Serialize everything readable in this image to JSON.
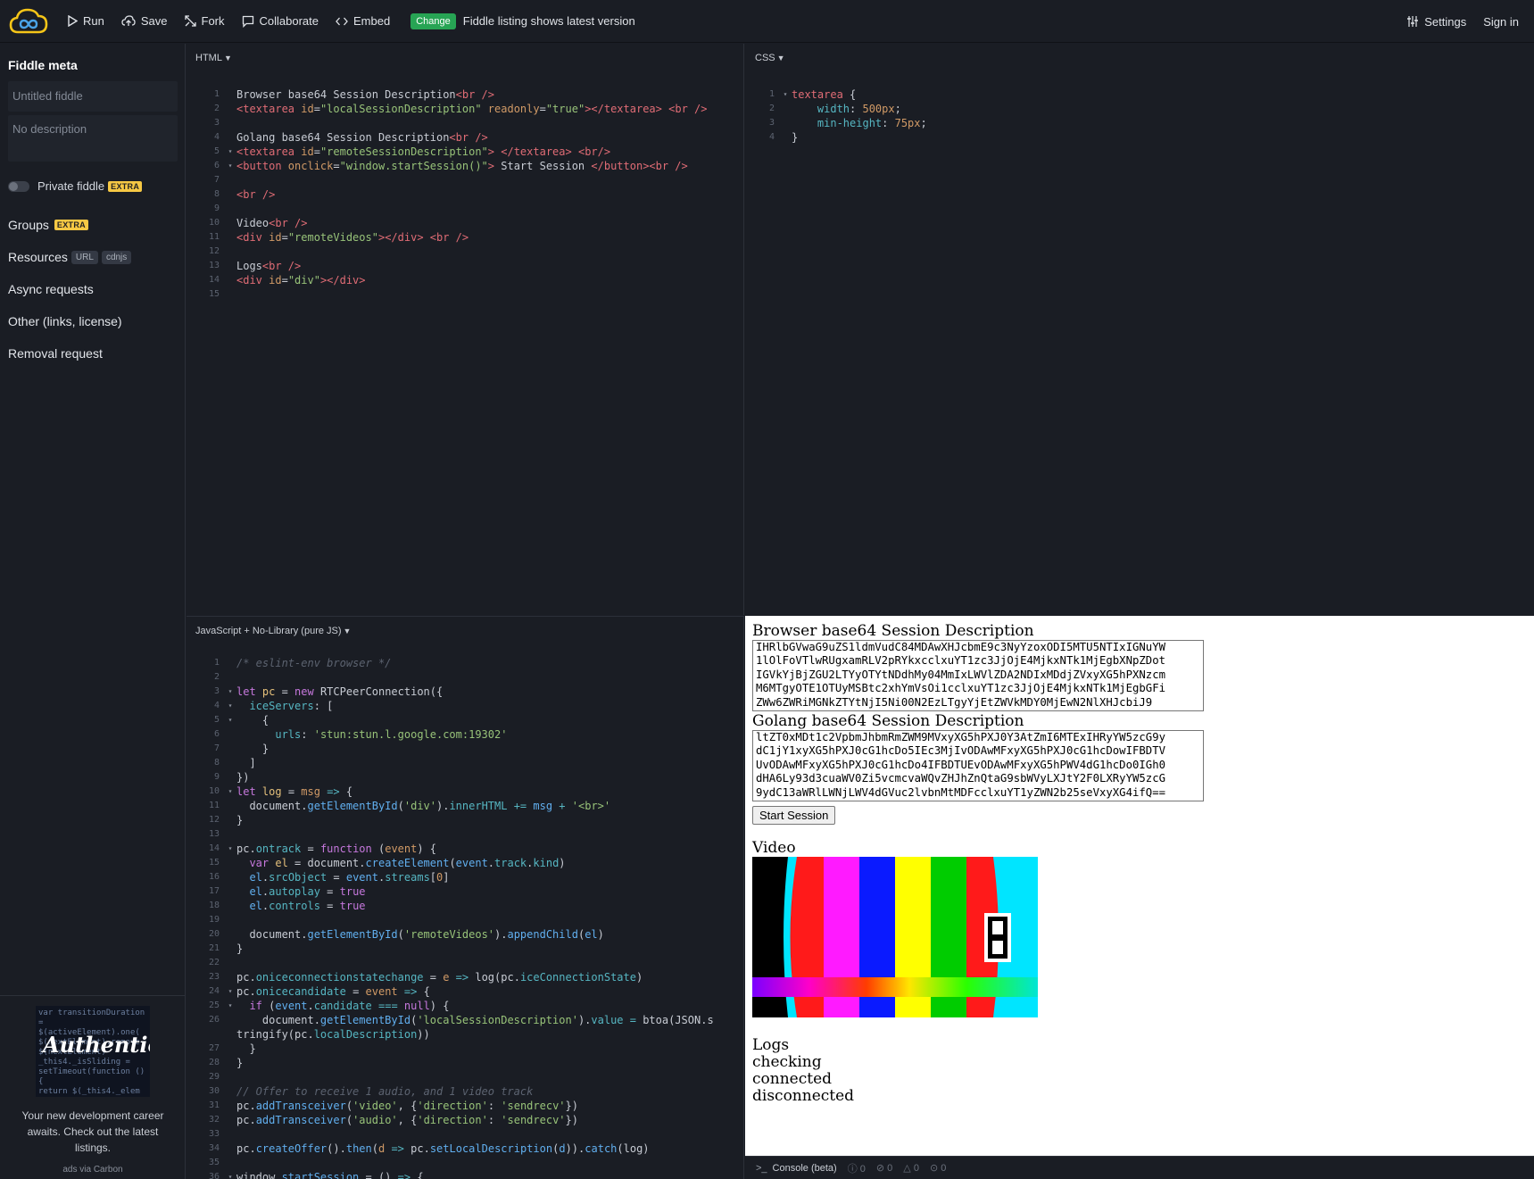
{
  "topbar": {
    "run": "Run",
    "save": "Save",
    "fork": "Fork",
    "collaborate": "Collaborate",
    "embed": "Embed",
    "change_badge": "Change",
    "notice": "Fiddle listing shows latest version",
    "settings": "Settings",
    "sign_in": "Sign in"
  },
  "sidebar": {
    "title": "Fiddle meta",
    "title_placeholder": "Untitled fiddle",
    "description_placeholder": "No description",
    "private_label": "Private fiddle",
    "extra_badge": "EXTRA",
    "groups": "Groups",
    "resources": "Resources",
    "resources_url": "URL",
    "resources_cdnjs": "cdnjs",
    "async": "Async requests",
    "other": "Other (links, license)",
    "removal": "Removal request"
  },
  "ad": {
    "word": "Authentic",
    "text": "Your new development career awaits. Check out the latest listings.",
    "via": "ads via Carbon"
  },
  "panels": {
    "html": "HTML",
    "css": "CSS",
    "js": "JavaScript + No-Library (pure JS)"
  },
  "result": {
    "browser_label": "Browser base64 Session Description",
    "browser_value": "IHRlbGVwaG9uZS1ldmVudC84MDAwXHJcbmE9c3NyYzoxODI5MTU5NTIxIGNuYW\n1lOlFoVTlwRUgxamRLV2pRYkxcclxuYT1zc3JjOjE4MjkxNTk1MjEgbXNpZDot\nIGVkYjBjZGU2LTYyOTYtNDdhMy04MmIxLWVlZDA2NDIxMDdjZVxyXG5hPXNzcm\nM6MTgyOTE1OTUyMSBtc2xhYmVsOi1cclxuYT1zc3JjOjE4MjkxNTk1MjEgbGFi\nZWw6ZWRiMGNkZTYtNjI5Ni00N2EzLTgyYjEtZWVkMDY0MjEwN2NlXHJcbiJ9",
    "golang_label": "Golang base64 Session Description",
    "golang_value": "ltZT0xMDt1c2VpbmJhbmRmZWM9MVxyXG5hPXJ0Y3AtZmI6MTExIHRyYW5zcG9y\ndC1jY1xyXG5hPXJ0cG1hcDo5IEc3MjIvODAwMFxyXG5hPXJ0cG1hcDowIFBDTV\nUvODAwMFxyXG5hPXJ0cG1hcDo4IFBDTUEvODAwMFxyXG5hPWV4dG1hcDo0IGh0\ndHA6Ly93d3cuaWV0Zi5vcmcvaWQvZHJhZnQtaG9sbWVyLXJtY2F0LXRyYW5zcG\n9ydC13aWRlLWNjLWV4dGVuc2lvbnMtMDFcclxuYT1yZWN2b25seVxyXG4ifQ==",
    "start_button": "Start Session",
    "video_label": "Video",
    "logs_label": "Logs",
    "logs": [
      "checking",
      "connected",
      "disconnected"
    ]
  },
  "console": {
    "label": "Console (beta)",
    "counts": [
      "0",
      "0",
      "0",
      "0"
    ]
  },
  "html_code": [
    [
      [
        "tx",
        "Browser base64 Session Description"
      ],
      [
        "tag",
        "<br />"
      ]
    ],
    [
      [
        "tag",
        "<textarea "
      ],
      [
        "attr",
        "id"
      ],
      [
        "tx",
        "="
      ],
      [
        "str",
        "\"localSessionDescription\""
      ],
      [
        "tx",
        " "
      ],
      [
        "attr",
        "readonly"
      ],
      [
        "tx",
        "="
      ],
      [
        "str",
        "\"true\""
      ],
      [
        "tag",
        "></textarea>"
      ],
      [
        "tx",
        " "
      ],
      [
        "tag",
        "<br />"
      ]
    ],
    [],
    [
      [
        "tx",
        "Golang base64 Session Description"
      ],
      [
        "tag",
        "<br />"
      ]
    ],
    [
      [
        "tag",
        "<textarea "
      ],
      [
        "attr",
        "id"
      ],
      [
        "tx",
        "="
      ],
      [
        "str",
        "\"remoteSessionDescription\""
      ],
      [
        "tag",
        ">"
      ],
      [
        "tx",
        " "
      ],
      [
        "tag",
        "</textarea>"
      ],
      [
        "tx",
        " "
      ],
      [
        "tag",
        "<br/>"
      ]
    ],
    [
      [
        "tag",
        "<button "
      ],
      [
        "attr",
        "onclick"
      ],
      [
        "tx",
        "="
      ],
      [
        "str",
        "\"window.startSession()\""
      ],
      [
        "tag",
        ">"
      ],
      [
        "tx",
        " Start Session "
      ],
      [
        "tag",
        "</button><br />"
      ]
    ],
    [],
    [
      [
        "tag",
        "<br />"
      ]
    ],
    [],
    [
      [
        "tx",
        "Video"
      ],
      [
        "tag",
        "<br />"
      ]
    ],
    [
      [
        "tag",
        "<div "
      ],
      [
        "attr",
        "id"
      ],
      [
        "tx",
        "="
      ],
      [
        "str",
        "\"remoteVideos\""
      ],
      [
        "tag",
        "></div>"
      ],
      [
        "tx",
        " "
      ],
      [
        "tag",
        "<br />"
      ]
    ],
    [],
    [
      [
        "tx",
        "Logs"
      ],
      [
        "tag",
        "<br />"
      ]
    ],
    [
      [
        "tag",
        "<div "
      ],
      [
        "attr",
        "id"
      ],
      [
        "tx",
        "="
      ],
      [
        "str",
        "\"div\""
      ],
      [
        "tag",
        "></div>"
      ]
    ],
    []
  ],
  "html_folds": [
    0,
    0,
    0,
    0,
    1,
    1,
    0,
    0,
    0,
    0,
    0,
    0,
    0,
    0,
    0
  ],
  "css_code": [
    [
      [
        "tag",
        "textarea"
      ],
      [
        "tx",
        " {"
      ]
    ],
    [
      [
        "tx",
        "    "
      ],
      [
        "prop",
        "width"
      ],
      [
        "tx",
        ": "
      ],
      [
        "num",
        "500px"
      ],
      [
        "tx",
        ";"
      ]
    ],
    [
      [
        "tx",
        "    "
      ],
      [
        "prop",
        "min-height"
      ],
      [
        "tx",
        ": "
      ],
      [
        "num",
        "75px"
      ],
      [
        "tx",
        ";"
      ]
    ],
    [
      [
        "tx",
        "}"
      ]
    ]
  ],
  "css_folds": [
    1,
    0,
    0,
    0
  ],
  "js_code": [
    [
      [
        "cmt",
        "/* eslint-env browser */"
      ]
    ],
    [],
    [
      [
        "kw",
        "let "
      ],
      [
        "vn",
        "pc"
      ],
      [
        "tx",
        " = "
      ],
      [
        "kw",
        "new "
      ],
      [
        "tx",
        "RTCPeerConnection({"
      ]
    ],
    [
      [
        "tx",
        "  "
      ],
      [
        "prop",
        "iceServers"
      ],
      [
        "tx",
        ": ["
      ]
    ],
    [
      [
        "tx",
        "    {"
      ]
    ],
    [
      [
        "tx",
        "      "
      ],
      [
        "prop",
        "urls"
      ],
      [
        "tx",
        ": "
      ],
      [
        "str",
        "'stun:stun.l.google.com:19302'"
      ]
    ],
    [
      [
        "tx",
        "    }"
      ]
    ],
    [
      [
        "tx",
        "  ]"
      ]
    ],
    [
      [
        "tx",
        "})"
      ]
    ],
    [
      [
        "kw",
        "let "
      ],
      [
        "vn",
        "log"
      ],
      [
        "tx",
        " = "
      ],
      [
        "attr",
        "msg"
      ],
      [
        "op",
        " => "
      ],
      [
        "tx",
        "{"
      ]
    ],
    [
      [
        "tx",
        "  document."
      ],
      [
        "fn",
        "getElementById"
      ],
      [
        "tx",
        "("
      ],
      [
        "str",
        "'div'"
      ],
      [
        "tx",
        ")."
      ],
      [
        "prop",
        "innerHTML"
      ],
      [
        "op",
        " += "
      ],
      [
        "fn",
        "msg"
      ],
      [
        "op",
        " + "
      ],
      [
        "str",
        "'<br>'"
      ]
    ],
    [
      [
        "tx",
        "}"
      ]
    ],
    [],
    [
      [
        "tx",
        "pc."
      ],
      [
        "prop",
        "ontrack"
      ],
      [
        "tx",
        " = "
      ],
      [
        "kw",
        "function "
      ],
      [
        "tx",
        "("
      ],
      [
        "attr",
        "event"
      ],
      [
        "tx",
        ") {"
      ]
    ],
    [
      [
        "tx",
        "  "
      ],
      [
        "kw",
        "var "
      ],
      [
        "vn",
        "el"
      ],
      [
        "tx",
        " = document."
      ],
      [
        "fn",
        "createElement"
      ],
      [
        "tx",
        "("
      ],
      [
        "fn",
        "event"
      ],
      [
        "tx",
        "."
      ],
      [
        "prop",
        "track"
      ],
      [
        "tx",
        "."
      ],
      [
        "prop",
        "kind"
      ],
      [
        "tx",
        ")"
      ]
    ],
    [
      [
        "tx",
        "  "
      ],
      [
        "fn",
        "el"
      ],
      [
        "tx",
        "."
      ],
      [
        "prop",
        "srcObject"
      ],
      [
        "tx",
        " = "
      ],
      [
        "fn",
        "event"
      ],
      [
        "tx",
        "."
      ],
      [
        "prop",
        "streams"
      ],
      [
        "tx",
        "["
      ],
      [
        "num",
        "0"
      ],
      [
        "tx",
        "]"
      ]
    ],
    [
      [
        "tx",
        "  "
      ],
      [
        "fn",
        "el"
      ],
      [
        "tx",
        "."
      ],
      [
        "prop",
        "autoplay"
      ],
      [
        "tx",
        " = "
      ],
      [
        "kw",
        "true"
      ]
    ],
    [
      [
        "tx",
        "  "
      ],
      [
        "fn",
        "el"
      ],
      [
        "tx",
        "."
      ],
      [
        "prop",
        "controls"
      ],
      [
        "tx",
        " = "
      ],
      [
        "kw",
        "true"
      ]
    ],
    [],
    [
      [
        "tx",
        "  document."
      ],
      [
        "fn",
        "getElementById"
      ],
      [
        "tx",
        "("
      ],
      [
        "str",
        "'remoteVideos'"
      ],
      [
        "tx",
        ")."
      ],
      [
        "fn",
        "appendChild"
      ],
      [
        "tx",
        "("
      ],
      [
        "fn",
        "el"
      ],
      [
        "tx",
        ")"
      ]
    ],
    [
      [
        "tx",
        "}"
      ]
    ],
    [],
    [
      [
        "tx",
        "pc."
      ],
      [
        "prop",
        "oniceconnectionstatechange"
      ],
      [
        "tx",
        " = "
      ],
      [
        "attr",
        "e"
      ],
      [
        "op",
        " => "
      ],
      [
        "tx",
        "log(pc."
      ],
      [
        "prop",
        "iceConnectionState"
      ],
      [
        "tx",
        ")"
      ]
    ],
    [
      [
        "tx",
        "pc."
      ],
      [
        "prop",
        "onicecandidate"
      ],
      [
        "tx",
        " = "
      ],
      [
        "attr",
        "event"
      ],
      [
        "op",
        " => "
      ],
      [
        "tx",
        "{"
      ]
    ],
    [
      [
        "tx",
        "  "
      ],
      [
        "kw",
        "if "
      ],
      [
        "tx",
        "("
      ],
      [
        "fn",
        "event"
      ],
      [
        "tx",
        "."
      ],
      [
        "prop",
        "candidate"
      ],
      [
        "op",
        " === "
      ],
      [
        "kw",
        "null"
      ],
      [
        "tx",
        ") {"
      ]
    ],
    [
      [
        "tx",
        "    document."
      ],
      [
        "fn",
        "getElementById"
      ],
      [
        "tx",
        "("
      ],
      [
        "str",
        "'localSessionDescription'"
      ],
      [
        "tx",
        ")."
      ],
      [
        "prop",
        "value"
      ],
      [
        "op",
        " = "
      ],
      [
        "tx",
        "btoa(JSON.s"
      ]
    ],
    [
      [
        "tx",
        "tringify(pc."
      ],
      [
        "prop",
        "localDescription"
      ],
      [
        "tx",
        "))"
      ]
    ],
    [
      [
        "tx",
        "  }"
      ]
    ],
    [
      [
        "tx",
        "}"
      ]
    ],
    [],
    [
      [
        "cmt",
        "// Offer to receive 1 audio, and 1 video track"
      ]
    ],
    [
      [
        "tx",
        "pc."
      ],
      [
        "fn",
        "addTransceiver"
      ],
      [
        "tx",
        "("
      ],
      [
        "str",
        "'video'"
      ],
      [
        "tx",
        ", {"
      ],
      [
        "str",
        "'direction'"
      ],
      [
        "tx",
        ": "
      ],
      [
        "str",
        "'sendrecv'"
      ],
      [
        "tx",
        "})"
      ]
    ],
    [
      [
        "tx",
        "pc."
      ],
      [
        "fn",
        "addTransceiver"
      ],
      [
        "tx",
        "("
      ],
      [
        "str",
        "'audio'"
      ],
      [
        "tx",
        ", {"
      ],
      [
        "str",
        "'direction'"
      ],
      [
        "tx",
        ": "
      ],
      [
        "str",
        "'sendrecv'"
      ],
      [
        "tx",
        "})"
      ]
    ],
    [],
    [
      [
        "tx",
        "pc."
      ],
      [
        "fn",
        "createOffer"
      ],
      [
        "tx",
        "()."
      ],
      [
        "fn",
        "then"
      ],
      [
        "tx",
        "("
      ],
      [
        "attr",
        "d"
      ],
      [
        "op",
        " => "
      ],
      [
        "tx",
        "pc."
      ],
      [
        "fn",
        "setLocalDescription"
      ],
      [
        "tx",
        "("
      ],
      [
        "fn",
        "d"
      ],
      [
        "tx",
        "))."
      ],
      [
        "fn",
        "catch"
      ],
      [
        "tx",
        "(log)"
      ]
    ],
    [],
    [
      [
        "tx",
        "window."
      ],
      [
        "fn",
        "startSession"
      ],
      [
        "tx",
        " = () "
      ],
      [
        "op",
        "=>"
      ],
      [
        "tx",
        " {"
      ]
    ]
  ],
  "js_line_numbers": [
    "1",
    "2",
    "3",
    "4",
    "5",
    "6",
    "7",
    "8",
    "9",
    "10",
    "11",
    "12",
    "13",
    "14",
    "15",
    "16",
    "17",
    "18",
    "19",
    "20",
    "21",
    "22",
    "23",
    "24",
    "25",
    "26",
    "",
    "27",
    "28",
    "29",
    "30",
    "31",
    "32",
    "33",
    "34",
    "35",
    "36"
  ],
  "js_folds": [
    0,
    0,
    1,
    1,
    1,
    0,
    0,
    0,
    0,
    1,
    0,
    0,
    0,
    1,
    0,
    0,
    0,
    0,
    0,
    0,
    0,
    0,
    0,
    1,
    1,
    0,
    0,
    0,
    0,
    0,
    0,
    0,
    0,
    0,
    0,
    0,
    1
  ],
  "colors": {
    "background": "#1a1d24",
    "accent_green": "#27a454",
    "extra_badge": "#f6c844",
    "logo_yellow": "#f5c518"
  }
}
